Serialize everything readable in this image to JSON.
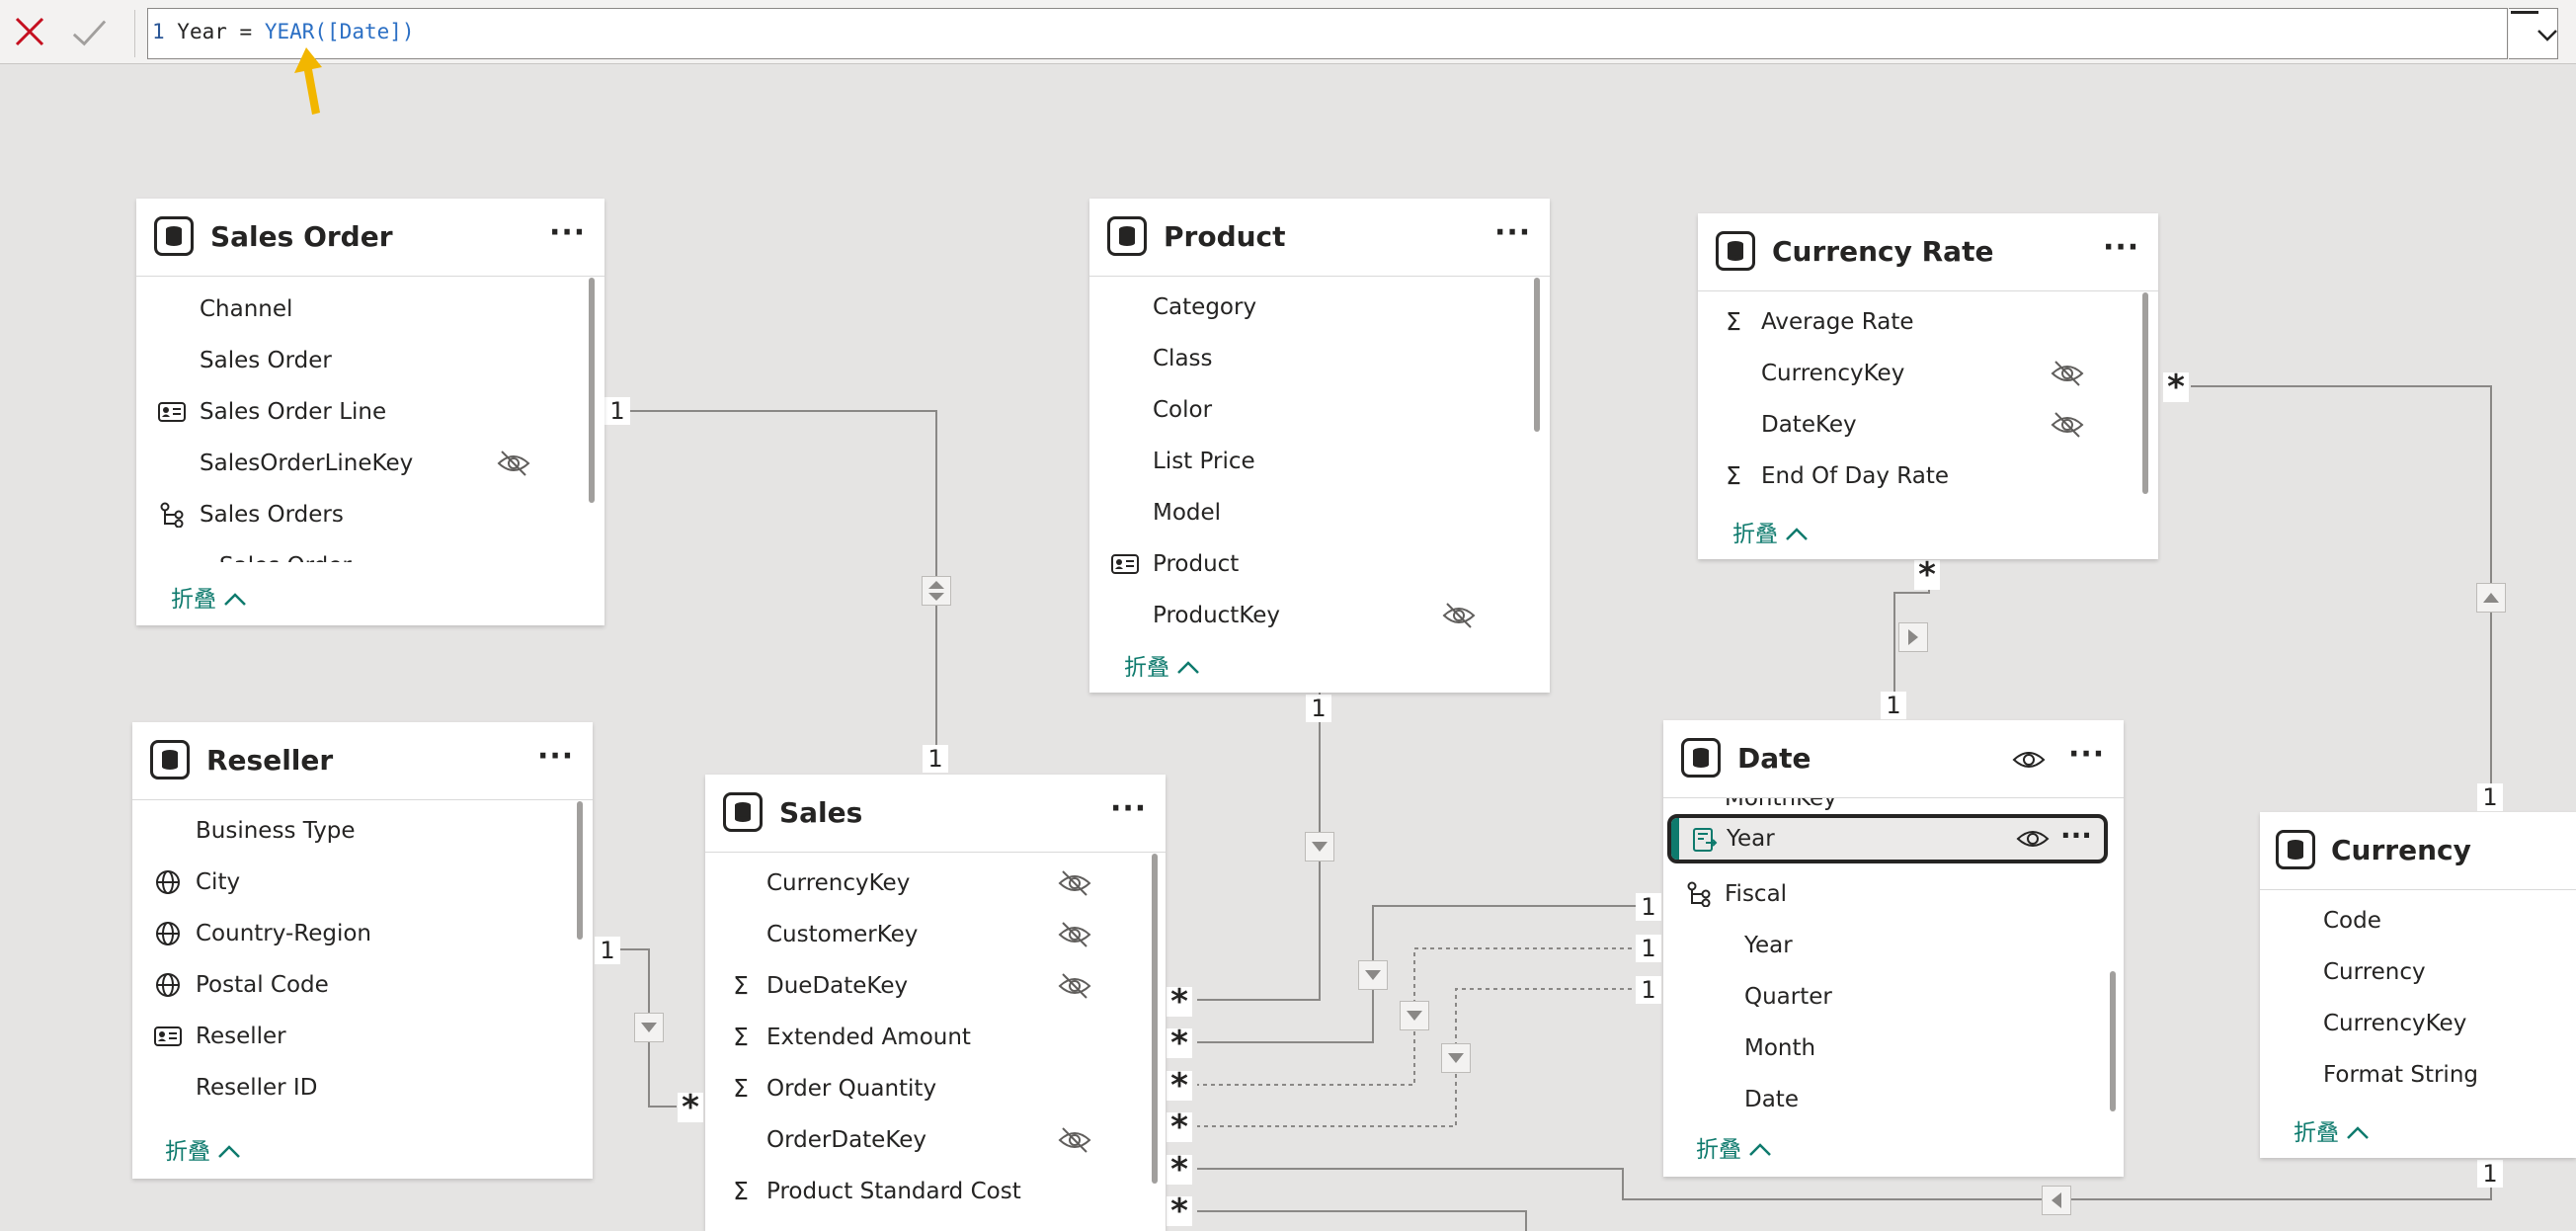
{
  "formula": {
    "line_no": "1",
    "prefix": " Year = ",
    "func": "YEAR([Date])",
    "cancel_icon": "close-icon",
    "commit_icon": "check-icon"
  },
  "collapse_label": "折叠",
  "sales_order": {
    "title": "Sales Order",
    "fields": [
      "Channel",
      "Sales Order",
      "Sales Order Line",
      "SalesOrderLineKey",
      "Sales Orders",
      "Sales Order"
    ]
  },
  "product": {
    "title": "Product",
    "fields": [
      "Category",
      "Class",
      "Color",
      "List Price",
      "Model",
      "Product",
      "ProductKey"
    ]
  },
  "currency_rate": {
    "title": "Currency Rate",
    "fields": [
      "Average Rate",
      "CurrencyKey",
      "DateKey",
      "End Of Day Rate"
    ]
  },
  "reseller": {
    "title": "Reseller",
    "fields": [
      "Business Type",
      "City",
      "Country-Region",
      "Postal Code",
      "Reseller",
      "Reseller ID"
    ]
  },
  "sales": {
    "title": "Sales",
    "fields": [
      "CurrencyKey",
      "CustomerKey",
      "DueDateKey",
      "Extended Amount",
      "Order Quantity",
      "OrderDateKey",
      "Product Standard Cost"
    ]
  },
  "date": {
    "title": "Date",
    "fields": [
      "MonthKey",
      "Year",
      "Fiscal",
      "Year",
      "Quarter",
      "Month",
      "Date"
    ]
  },
  "currency": {
    "title": "Currency",
    "fields": [
      "Code",
      "Currency",
      "CurrencyKey",
      "Format String"
    ]
  },
  "rel": {
    "one": "1",
    "many": "*"
  },
  "colors": {
    "accent": "#0e7a6d",
    "line": "#8a8886",
    "arrow": "#f2b600"
  }
}
